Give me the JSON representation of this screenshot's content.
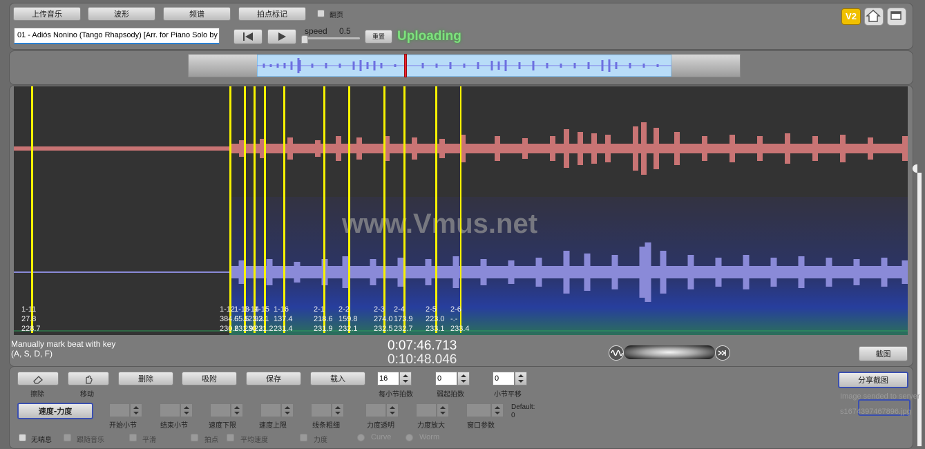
{
  "toolbar": {
    "upload_music": "上传音乐",
    "waveform": "波形",
    "spectrum": "频谱",
    "beat_mark": "拍点标记",
    "flip_page": "翻页",
    "file_name": "01 - Adiós Nonino (Tango Rhapsody) [Arr. for Piano Solo by",
    "speed_label": "speed",
    "speed_value": "0.5",
    "reset": "重置",
    "status": "Uploading",
    "v2_badge": "V2"
  },
  "markers": [
    {
      "label": "1-11",
      "v1": "27.8",
      "v2": "228.7"
    },
    {
      "label": "1-12",
      "v1": "384.5",
      "v2": "230.6"
    },
    {
      "label": "1-13",
      "v1": "65.5",
      "v2": "231.9"
    },
    {
      "label": "1-14",
      "v1": "123.2",
      "v2": "230.2"
    },
    {
      "label": "1-15",
      "v1": "93.1",
      "v2": "231.2"
    },
    {
      "label": "1-16",
      "v1": "137.4",
      "v2": "231.4"
    },
    {
      "label": "2-1",
      "v1": "218.6",
      "v2": "231.9"
    },
    {
      "label": "2-2",
      "v1": "159.8",
      "v2": "232.1"
    },
    {
      "label": "2-3",
      "v1": "274.0",
      "v2": "232.5"
    },
    {
      "label": "2-4",
      "v1": "173.9",
      "v2": "232.7"
    },
    {
      "label": "2-5",
      "v1": "223.0",
      "v2": "233.1"
    },
    {
      "label": "2-6",
      "v1": "-.-",
      "v2": "233.4"
    }
  ],
  "watermark": "www.Vmus.net",
  "info": {
    "hint_line1": "Manually mark beat with key",
    "hint_line2": "(A, S, D, F)",
    "time_current": "0:07:46.713",
    "time_total": "0:10:48.046",
    "screenshot": "截图"
  },
  "controls": {
    "erase": "擦除",
    "move": "移动",
    "delete": "删除",
    "snap": "吸附",
    "save": "保存",
    "load": "载入",
    "beats_per_bar_value": "16",
    "beats_per_bar_label": "每小节拍数",
    "pickup_value": "0",
    "pickup_label": "弱起拍数",
    "bar_shift_value": "0",
    "bar_shift_label": "小节平移",
    "share_screenshot": "分享截图",
    "sent_msg": "Image sended to server",
    "file_id": "s1674397467896.jpg",
    "speed_force": "速度-力度",
    "start_bar": "开始小节",
    "end_bar": "结束小节",
    "speed_min": "速度下限",
    "speed_max": "速度上限",
    "line_width": "线条粗细",
    "force_opacity": "力度透明",
    "force_zoom": "力度放大",
    "window_param": "窗口参数",
    "default_label": "Default:",
    "default_value": "0",
    "no_breath": "无喘息",
    "follow_music": "跟随音乐",
    "smooth": "平滑",
    "beat_points": "拍点",
    "avg_speed": "平均速度",
    "force": "力度",
    "curve": "Curve",
    "worm": "Worm"
  }
}
